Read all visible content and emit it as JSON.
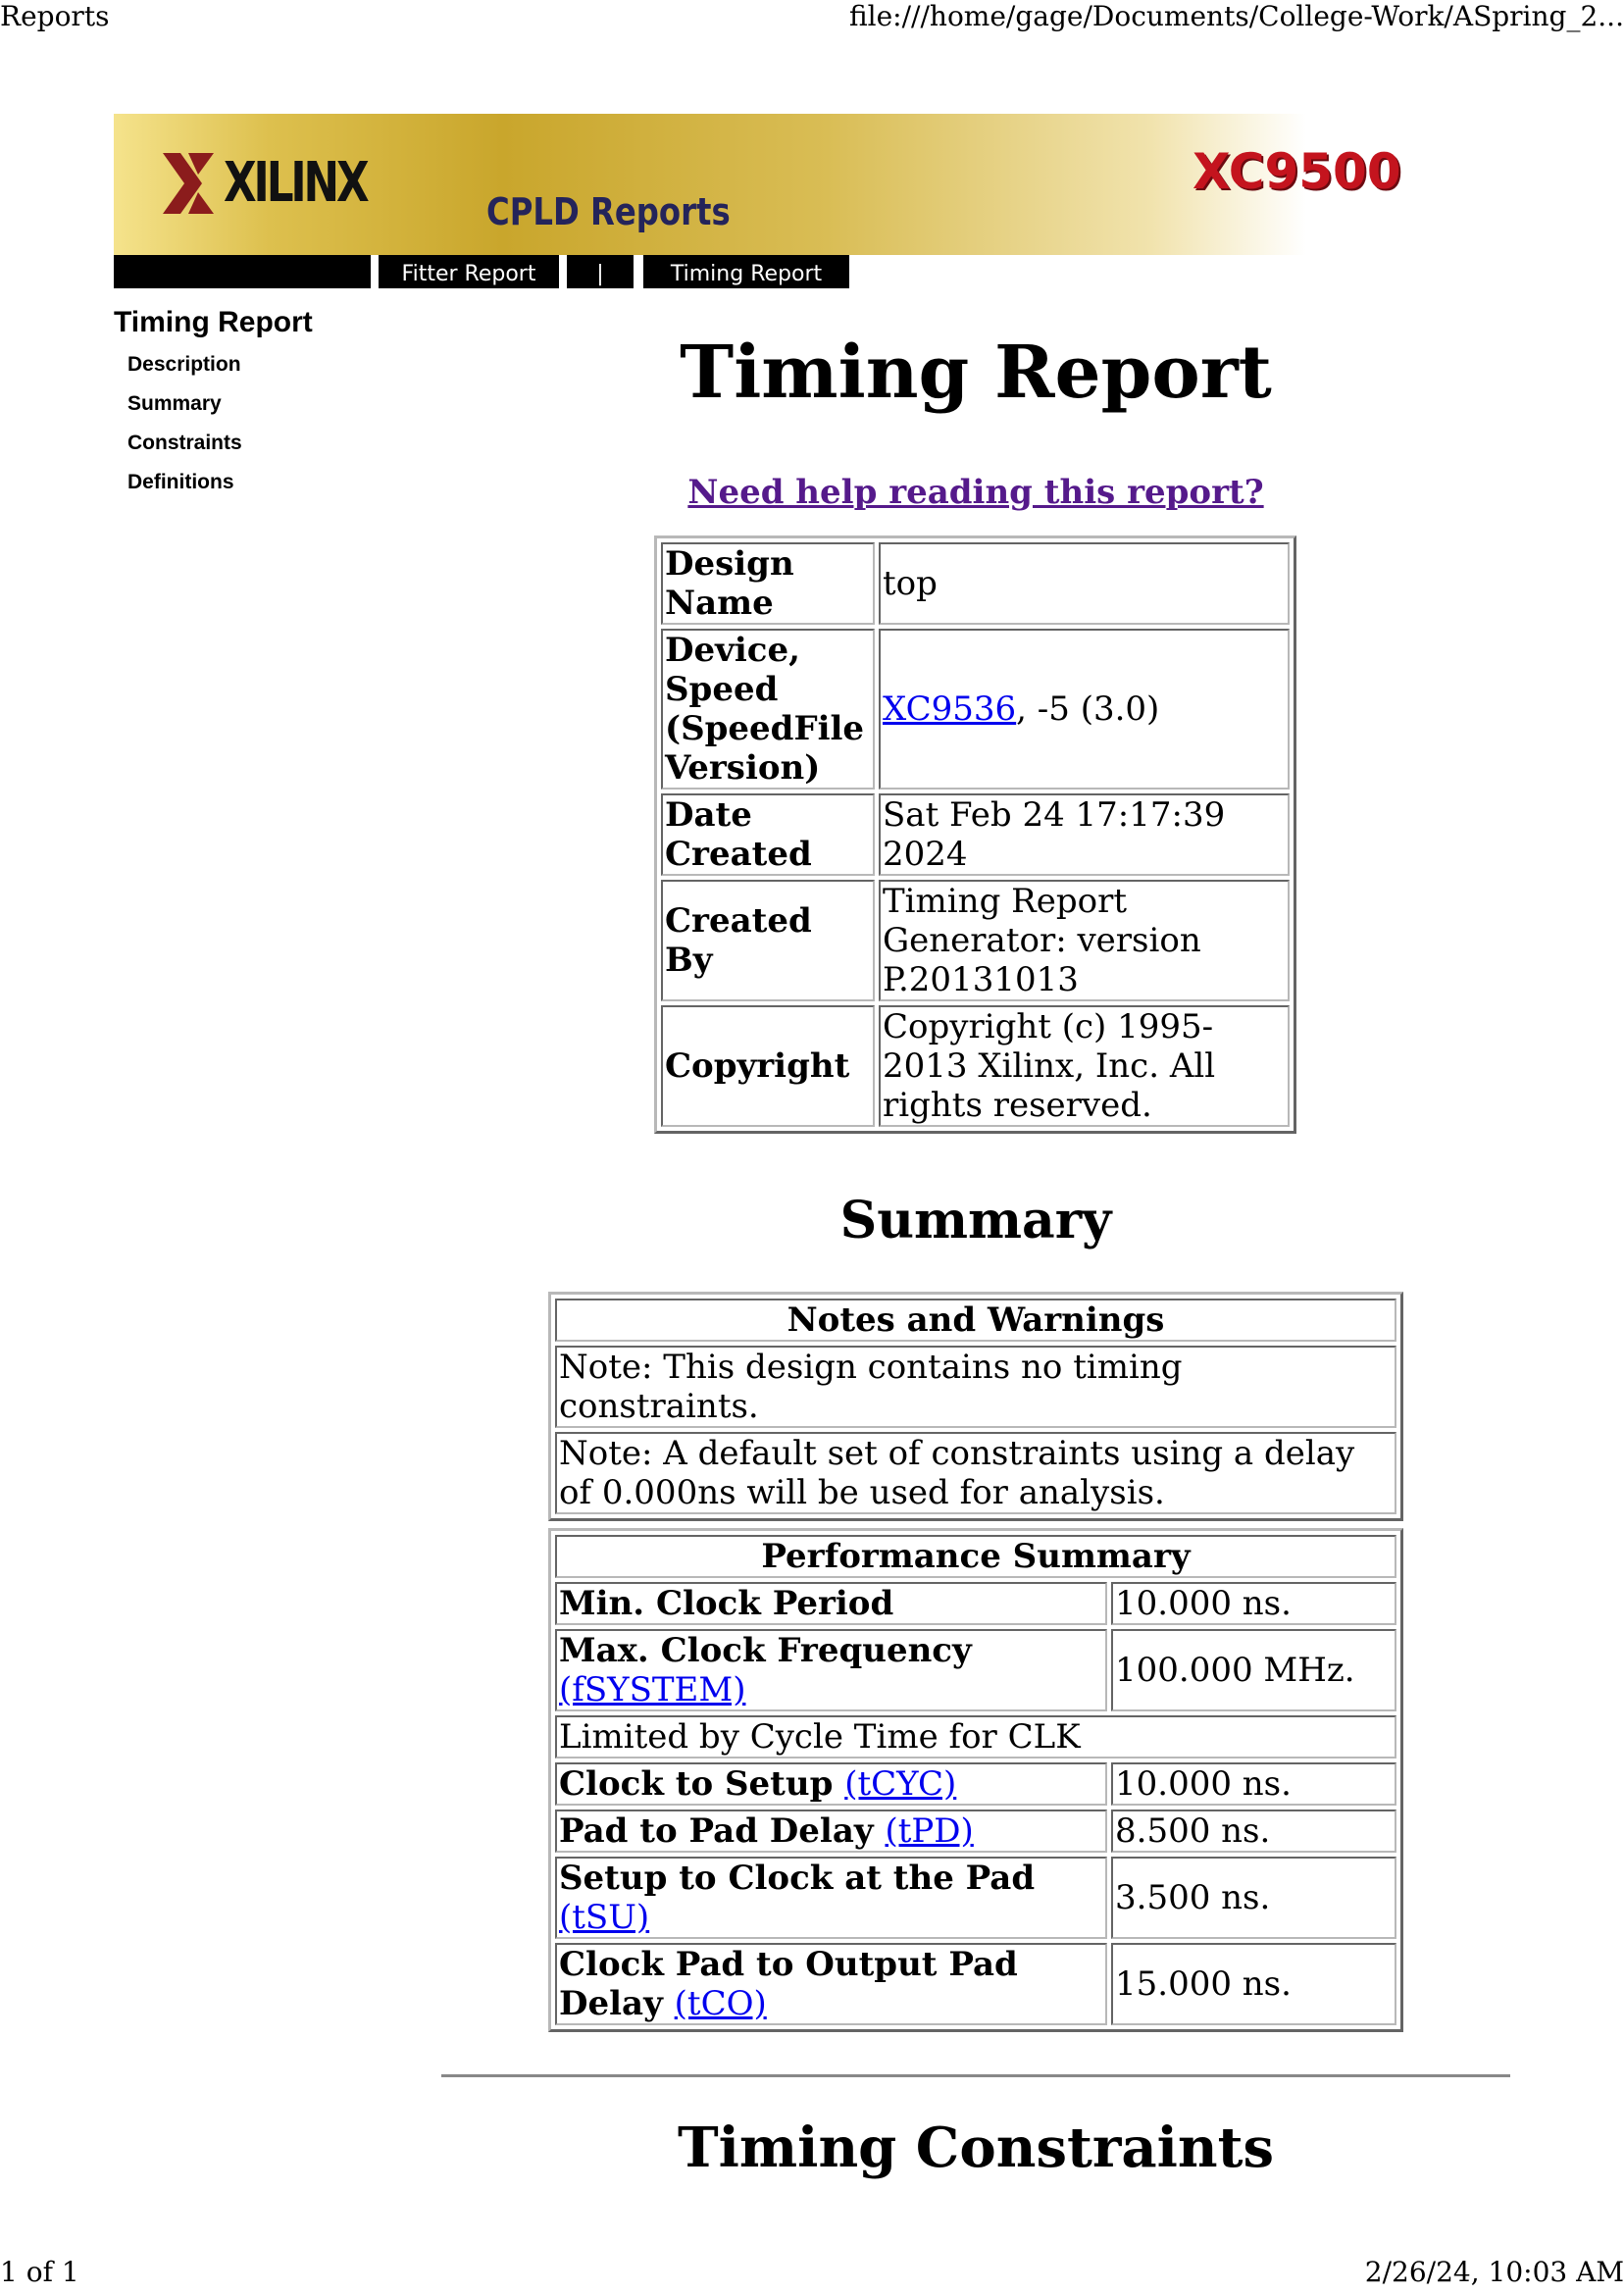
{
  "print_header": {
    "title": "Reports",
    "url": "file:///home/gage/Documents/College-Work/ASpring_2..."
  },
  "print_footer": {
    "page": "1 of 1",
    "datetime": "2/26/24, 10:03 AM"
  },
  "banner": {
    "logo_text": "XILINX",
    "subtitle": "CPLD Reports",
    "device_family": "XC9500",
    "brand_red": "#c4141e"
  },
  "navbar": {
    "items": [
      "",
      "Fitter Report",
      "|",
      "Timing Report"
    ]
  },
  "sidebar": {
    "title": "Timing Report",
    "items": [
      "Description",
      "Summary",
      "Constraints",
      "Definitions"
    ]
  },
  "main": {
    "title": "Timing Report",
    "help_link": "Need help reading this report?",
    "design_info": [
      {
        "label": "Design Name",
        "value": "top"
      },
      {
        "label": "Device, Speed (SpeedFile Version)",
        "value_link": "XC9536",
        "value": ", -5 (3.0)"
      },
      {
        "label": "Date Created",
        "value": "Sat Feb 24 17:17:39 2024"
      },
      {
        "label": "Created By",
        "value": "Timing Report Generator: version P.20131013"
      },
      {
        "label": "Copyright",
        "value": "Copyright (c) 1995-2013 Xilinx, Inc. All rights reserved."
      }
    ],
    "summary_heading": "Summary",
    "notes": {
      "header": "Notes and Warnings",
      "rows": [
        "Note: This design contains no timing constraints.",
        "Note: A default set of constraints using a delay of 0.000ns will be used for analysis."
      ]
    },
    "performance": {
      "header": "Performance Summary",
      "rows": [
        {
          "label": "Min. Clock Period",
          "link": "",
          "value": "10.000 ns."
        },
        {
          "label": "Max. Clock Frequency",
          "link": "(fSYSTEM)",
          "value": "100.000 MHz."
        },
        {
          "label": "Clock to Setup",
          "link": "(tCYC)",
          "value": "10.000 ns."
        },
        {
          "label": "Pad to Pad Delay",
          "link": "(tPD)",
          "value": "8.500 ns."
        },
        {
          "label": "Setup to Clock at the Pad",
          "link": "(tSU)",
          "value": "3.500 ns."
        },
        {
          "label": "Clock Pad to Output Pad Delay",
          "link": "(tCO)",
          "value": "15.000 ns."
        }
      ],
      "limited_by": "Limited by Cycle Time for CLK"
    },
    "constraints_heading": "Timing Constraints"
  }
}
